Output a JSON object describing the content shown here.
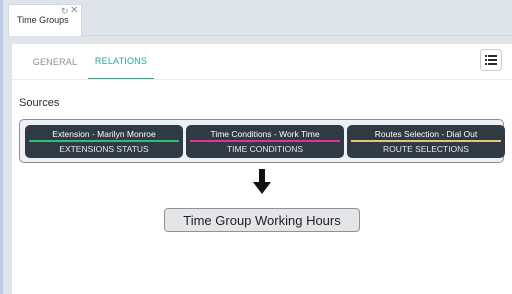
{
  "tab": {
    "title": "Time Groups",
    "refresh_icon": "refresh-icon",
    "close_icon": "close-icon"
  },
  "nav": {
    "general": "GENERAL",
    "relations": "RELATIONS",
    "active": "RELATIONS"
  },
  "toolbar": {
    "list_icon": "list-icon"
  },
  "sources": {
    "label": "Sources",
    "cards": [
      {
        "title": "Extension - Marilyn Monroe",
        "subtitle": "EXTENSIONS STATUS",
        "line_color": "#2fbf71"
      },
      {
        "title": "Time Conditions - Work Time",
        "subtitle": "TIME CONDITIONS",
        "line_color": "#e0339a"
      },
      {
        "title": "Routes Selection - Dial Out",
        "subtitle": "ROUTE SELECTIONS",
        "line_color": "#e7c27a"
      }
    ]
  },
  "target": {
    "label": "Time Group Working Hours"
  },
  "colors": {
    "accent": "#2aa59a",
    "card_bg": "#2f3a45"
  }
}
